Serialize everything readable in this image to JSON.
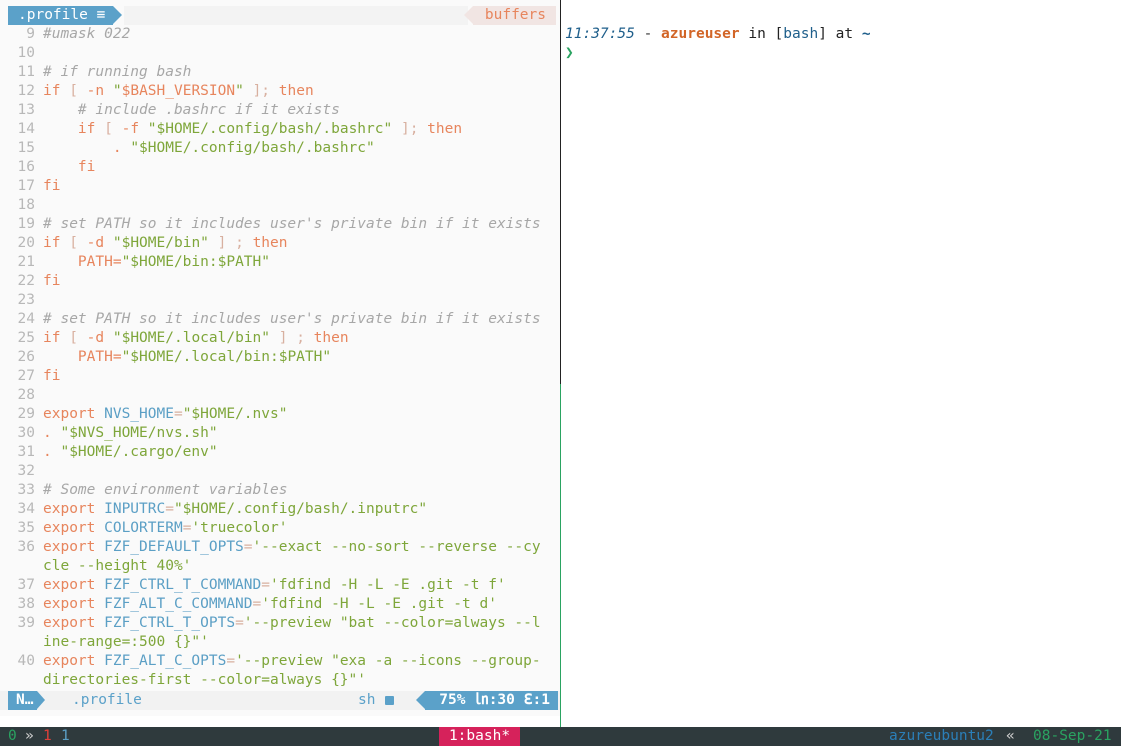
{
  "tabline": {
    "active_tab": ".profile",
    "active_tab_icon": "≡",
    "right_label": "buffers"
  },
  "editor": {
    "lines": [
      {
        "n": "9",
        "segs": [
          {
            "t": "#umask 022",
            "k": "c"
          }
        ]
      },
      {
        "n": "10",
        "segs": []
      },
      {
        "n": "11",
        "segs": [
          {
            "t": "# if running bash",
            "k": "c"
          }
        ]
      },
      {
        "n": "12",
        "segs": [
          {
            "t": "if",
            "k": "kw"
          },
          {
            "t": " [ ",
            "k": "op"
          },
          {
            "t": "-n",
            "k": "kw"
          },
          {
            "t": " \"",
            "k": "str"
          },
          {
            "t": "$BASH_VERSION",
            "k": "kw"
          },
          {
            "t": "\"",
            "k": "str"
          },
          {
            "t": " ]; ",
            "k": "op"
          },
          {
            "t": "then",
            "k": "kw"
          }
        ]
      },
      {
        "n": "13",
        "segs": [
          {
            "t": "    # include .bashrc if it exists",
            "k": "c"
          }
        ]
      },
      {
        "n": "14",
        "segs": [
          {
            "t": "    if",
            "k": "kw"
          },
          {
            "t": " [ ",
            "k": "op"
          },
          {
            "t": "-f",
            "k": "kw"
          },
          {
            "t": " \"$HOME/.config/bash/.bashrc\"",
            "k": "str"
          },
          {
            "t": " ]; ",
            "k": "op"
          },
          {
            "t": "then",
            "k": "kw"
          }
        ]
      },
      {
        "n": "15",
        "segs": [
          {
            "t": "        . ",
            "k": "kw"
          },
          {
            "t": "\"$HOME/.config/bash/.bashrc\"",
            "k": "str"
          }
        ]
      },
      {
        "n": "16",
        "segs": [
          {
            "t": "    fi",
            "k": "kw"
          }
        ]
      },
      {
        "n": "17",
        "segs": [
          {
            "t": "fi",
            "k": "kw"
          }
        ]
      },
      {
        "n": "18",
        "segs": []
      },
      {
        "n": "19",
        "segs": [
          {
            "t": "# set PATH so it includes user's private bin if it exists",
            "k": "c"
          }
        ]
      },
      {
        "n": "20",
        "segs": [
          {
            "t": "if",
            "k": "kw"
          },
          {
            "t": " [ ",
            "k": "op"
          },
          {
            "t": "-d",
            "k": "kw"
          },
          {
            "t": " \"$HOME/bin\"",
            "k": "str"
          },
          {
            "t": " ] ; ",
            "k": "op"
          },
          {
            "t": "then",
            "k": "kw"
          }
        ]
      },
      {
        "n": "21",
        "segs": [
          {
            "t": "    PATH=",
            "k": "kw"
          },
          {
            "t": "\"$HOME/bin:$PATH\"",
            "k": "str"
          }
        ]
      },
      {
        "n": "22",
        "segs": [
          {
            "t": "fi",
            "k": "kw"
          }
        ]
      },
      {
        "n": "23",
        "segs": []
      },
      {
        "n": "24",
        "segs": [
          {
            "t": "# set PATH so it includes user's private bin if it exists",
            "k": "c"
          }
        ]
      },
      {
        "n": "25",
        "segs": [
          {
            "t": "if",
            "k": "kw"
          },
          {
            "t": " [ ",
            "k": "op"
          },
          {
            "t": "-d",
            "k": "kw"
          },
          {
            "t": " \"$HOME/.local/bin\"",
            "k": "str"
          },
          {
            "t": " ] ; ",
            "k": "op"
          },
          {
            "t": "then",
            "k": "kw"
          }
        ]
      },
      {
        "n": "26",
        "segs": [
          {
            "t": "    PATH=",
            "k": "kw"
          },
          {
            "t": "\"$HOME/.local/bin:$PATH\"",
            "k": "str"
          }
        ]
      },
      {
        "n": "27",
        "segs": [
          {
            "t": "fi",
            "k": "kw"
          }
        ]
      },
      {
        "n": "28",
        "segs": []
      },
      {
        "n": "29",
        "segs": [
          {
            "t": "export ",
            "k": "kw"
          },
          {
            "t": "NVS_HOME",
            "k": "var"
          },
          {
            "t": "=",
            "k": "op"
          },
          {
            "t": "\"$HOME/.nvs\"",
            "k": "str"
          }
        ]
      },
      {
        "n": "30",
        "segs": [
          {
            "t": ". ",
            "k": "kw"
          },
          {
            "t": "\"$NVS_HOME/nvs.sh\"",
            "k": "str"
          }
        ]
      },
      {
        "n": "31",
        "segs": [
          {
            "t": ". ",
            "k": "kw"
          },
          {
            "t": "\"$HOME/.cargo/env\"",
            "k": "str"
          }
        ]
      },
      {
        "n": "32",
        "segs": []
      },
      {
        "n": "33",
        "segs": [
          {
            "t": "# Some environment variables",
            "k": "c"
          }
        ]
      },
      {
        "n": "34",
        "segs": [
          {
            "t": "export ",
            "k": "kw"
          },
          {
            "t": "INPUTRC",
            "k": "var"
          },
          {
            "t": "=",
            "k": "op"
          },
          {
            "t": "\"$HOME/.config/bash/.inputrc\"",
            "k": "str"
          }
        ]
      },
      {
        "n": "35",
        "segs": [
          {
            "t": "export ",
            "k": "kw"
          },
          {
            "t": "COLORTERM",
            "k": "var"
          },
          {
            "t": "=",
            "k": "op"
          },
          {
            "t": "'truecolor'",
            "k": "str"
          }
        ]
      },
      {
        "n": "36",
        "segs": [
          {
            "t": "export ",
            "k": "kw"
          },
          {
            "t": "FZF_DEFAULT_OPTS",
            "k": "var"
          },
          {
            "t": "=",
            "k": "op"
          },
          {
            "t": "'--exact --no-sort --reverse --cy",
            "k": "str"
          }
        ]
      },
      {
        "n": "",
        "segs": [
          {
            "t": "cle --height 40%'",
            "k": "str"
          }
        ]
      },
      {
        "n": "37",
        "segs": [
          {
            "t": "export ",
            "k": "kw"
          },
          {
            "t": "FZF_CTRL_T_COMMAND",
            "k": "var"
          },
          {
            "t": "=",
            "k": "op"
          },
          {
            "t": "'fdfind -H -L -E .git -t f'",
            "k": "str"
          }
        ]
      },
      {
        "n": "38",
        "segs": [
          {
            "t": "export ",
            "k": "kw"
          },
          {
            "t": "FZF_ALT_C_COMMAND",
            "k": "var"
          },
          {
            "t": "=",
            "k": "op"
          },
          {
            "t": "'fdfind -H -L -E .git -t d'",
            "k": "str"
          }
        ]
      },
      {
        "n": "39",
        "segs": [
          {
            "t": "export ",
            "k": "kw"
          },
          {
            "t": "FZF_CTRL_T_OPTS",
            "k": "var"
          },
          {
            "t": "=",
            "k": "op"
          },
          {
            "t": "'--preview \"bat --color=always --l",
            "k": "str"
          }
        ]
      },
      {
        "n": "",
        "segs": [
          {
            "t": "ine-range=:500 {}\"'",
            "k": "str"
          }
        ]
      },
      {
        "n": "40",
        "segs": [
          {
            "t": "export ",
            "k": "kw"
          },
          {
            "t": "FZF_ALT_C_OPTS",
            "k": "var"
          },
          {
            "t": "=",
            "k": "op"
          },
          {
            "t": "'--preview \"exa -a --icons --group-",
            "k": "str"
          }
        ]
      },
      {
        "n": "",
        "segs": [
          {
            "t": "directories-first --color=always {}\"'",
            "k": "str"
          }
        ]
      }
    ]
  },
  "statusline": {
    "mode": "N…",
    "filename": ".profile",
    "filetype": "sh",
    "position": "75% ㏑:30 ℇ:1"
  },
  "shell": {
    "time": "11:37:55",
    "dash": " - ",
    "user": "azureuser",
    "in": " in ",
    "bracket_open": "[",
    "shell_name": "bash",
    "bracket_close": "]",
    "at": " at ",
    "cwd": "~",
    "prompt": "❯"
  },
  "tmux": {
    "session": "0",
    "sep": "»",
    "pane_a": "1",
    "pane_b": "1",
    "window": "1:bash*",
    "host": "azureubuntu2",
    "arrow": "«",
    "date": "08-Sep-21"
  },
  "colors": {
    "accent_blue": "#5ba1c9",
    "keyword": "#e7855d",
    "string": "#7ea63a",
    "tmux_window": "#d6225b",
    "tmux_bg": "#2f3a3d"
  }
}
